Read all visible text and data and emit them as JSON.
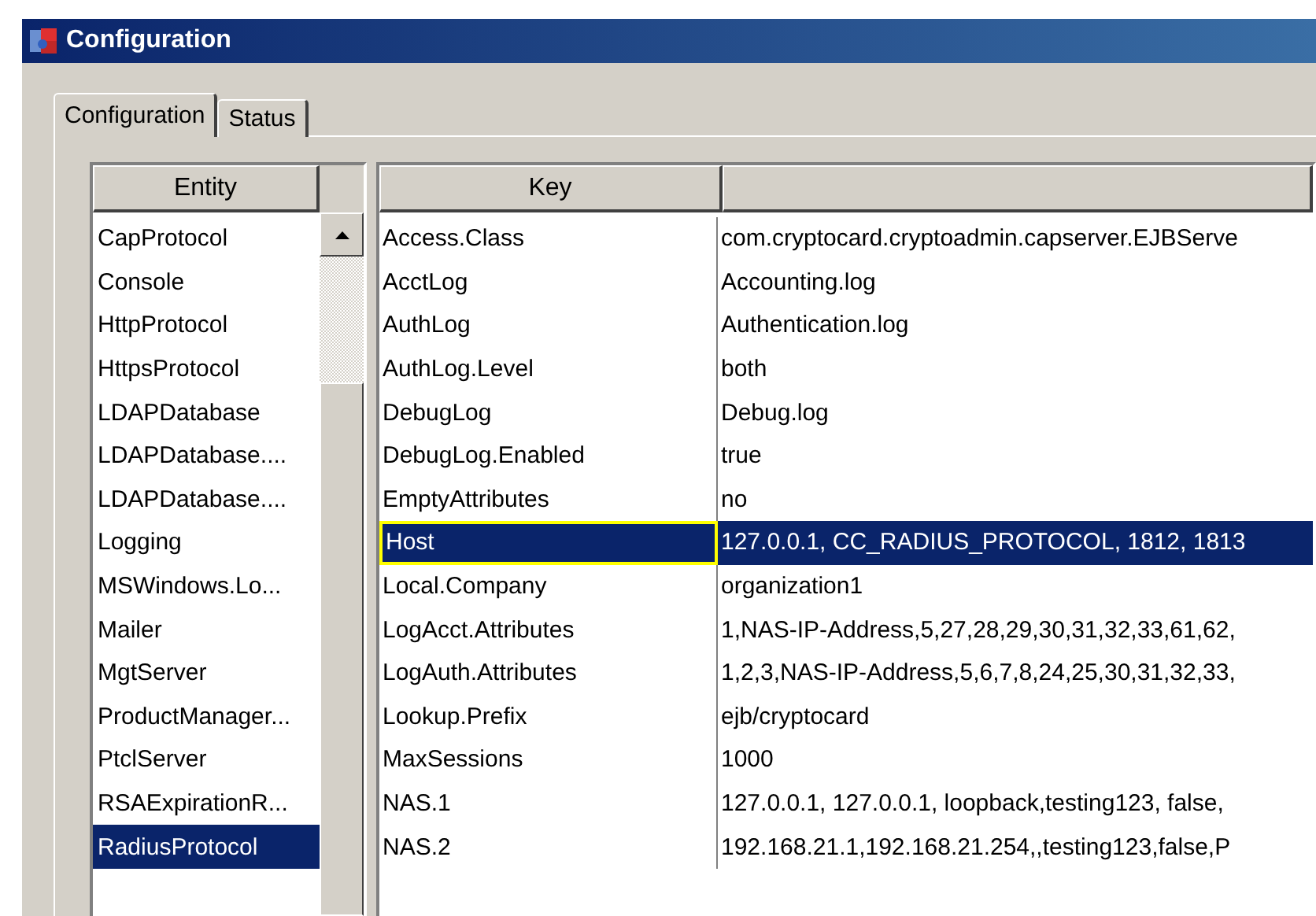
{
  "window": {
    "title": "Configuration"
  },
  "tabs": [
    {
      "label": "Configuration",
      "selected": true
    },
    {
      "label": "Status",
      "selected": false
    }
  ],
  "entity_list": {
    "column": "Entity",
    "items": [
      {
        "label": "CapProtocol",
        "selected": false
      },
      {
        "label": "Console",
        "selected": false
      },
      {
        "label": "HttpProtocol",
        "selected": false
      },
      {
        "label": "HttpsProtocol",
        "selected": false
      },
      {
        "label": "LDAPDatabase",
        "selected": false
      },
      {
        "label": "LDAPDatabase....",
        "selected": false
      },
      {
        "label": "LDAPDatabase....",
        "selected": false
      },
      {
        "label": "Logging",
        "selected": false
      },
      {
        "label": "MSWindows.Lo...",
        "selected": false
      },
      {
        "label": "Mailer",
        "selected": false
      },
      {
        "label": "MgtServer",
        "selected": false
      },
      {
        "label": "ProductManager...",
        "selected": false
      },
      {
        "label": "PtclServer",
        "selected": false
      },
      {
        "label": "RSAExpirationR...",
        "selected": false
      },
      {
        "label": "RadiusProtocol",
        "selected": true
      }
    ]
  },
  "table": {
    "columns": [
      "Key"
    ],
    "rows": [
      {
        "key": "Access.Class",
        "value": "com.cryptocard.cryptoadmin.capserver.EJBServe",
        "selected": false
      },
      {
        "key": "AcctLog",
        "value": "Accounting.log",
        "selected": false
      },
      {
        "key": "AuthLog",
        "value": "Authentication.log",
        "selected": false
      },
      {
        "key": "AuthLog.Level",
        "value": "both",
        "selected": false
      },
      {
        "key": "DebugLog",
        "value": "Debug.log",
        "selected": false
      },
      {
        "key": "DebugLog.Enabled",
        "value": "true",
        "selected": false
      },
      {
        "key": "EmptyAttributes",
        "value": "no",
        "selected": false
      },
      {
        "key": "Host",
        "value": "127.0.0.1, CC_RADIUS_PROTOCOL, 1812, 1813",
        "selected": true
      },
      {
        "key": "Local.Company",
        "value": "organization1",
        "selected": false
      },
      {
        "key": "LogAcct.Attributes",
        "value": "1,NAS-IP-Address,5,27,28,29,30,31,32,33,61,62,",
        "selected": false
      },
      {
        "key": "LogAuth.Attributes",
        "value": "1,2,3,NAS-IP-Address,5,6,7,8,24,25,30,31,32,33,",
        "selected": false
      },
      {
        "key": "Lookup.Prefix",
        "value": "ejb/cryptocard",
        "selected": false
      },
      {
        "key": "MaxSessions",
        "value": "1000",
        "selected": false
      },
      {
        "key": "NAS.1",
        "value": "127.0.0.1, 127.0.0.1, loopback,testing123, false,",
        "selected": false
      },
      {
        "key": "NAS.2",
        "value": "192.168.21.1,192.168.21.254,,testing123,false,P",
        "selected": false
      }
    ]
  }
}
